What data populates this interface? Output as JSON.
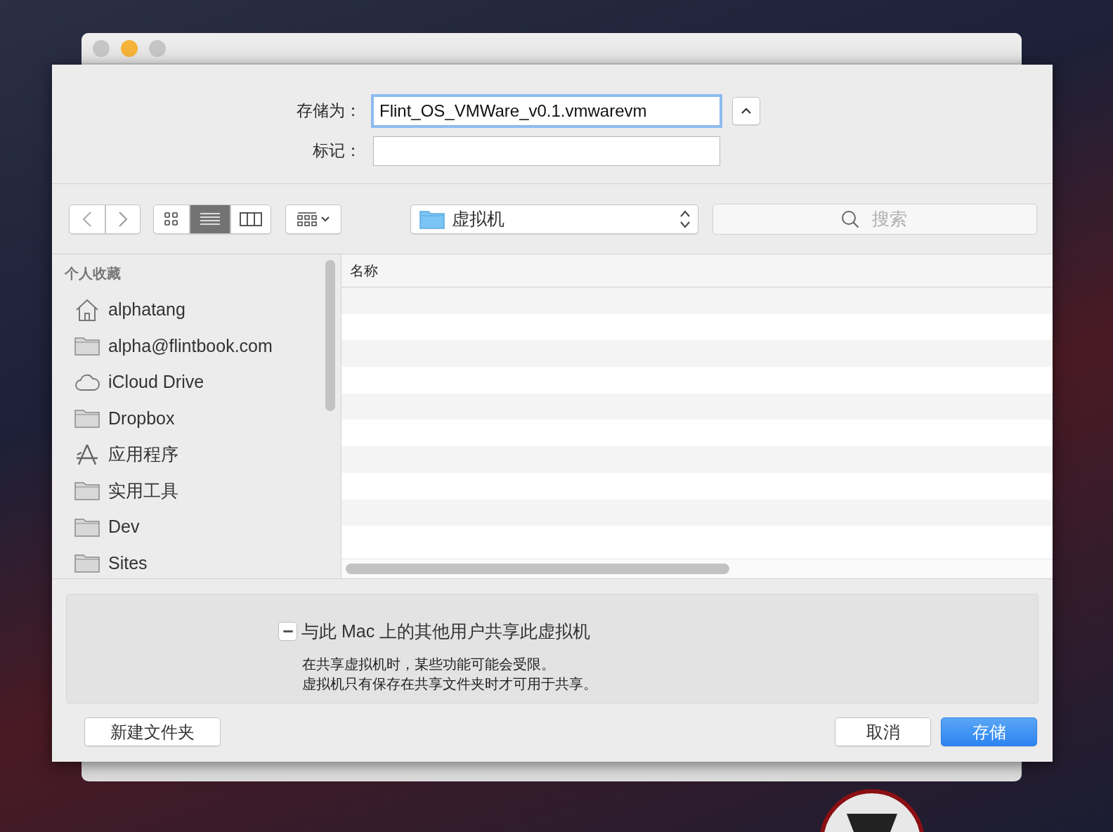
{
  "window": {
    "traffic_lights": [
      {
        "color": "#c6c6c6"
      },
      {
        "color": "#f6b33a"
      },
      {
        "color": "#c6c6c6"
      }
    ]
  },
  "form": {
    "fields": [
      {
        "label": "存储为：",
        "value": "Flint_OS_VMWare_v0.1.vmwarevm",
        "focused": true
      },
      {
        "label": "标记：",
        "focused": false
      }
    ]
  },
  "toolbar": {
    "view_modes": [
      {
        "kind": "icons",
        "selected": false
      },
      {
        "kind": "list",
        "selected": true
      },
      {
        "kind": "columns",
        "selected": false
      }
    ],
    "location": "虚拟机",
    "search": {
      "placeholder": "搜索"
    }
  },
  "sidebar": {
    "heading": "个人收藏",
    "items": [
      {
        "label": "alphatang",
        "kind": "home"
      },
      {
        "label": "alpha@flintbook.com",
        "kind": "folder"
      },
      {
        "label": "iCloud Drive",
        "kind": "cloud"
      },
      {
        "label": "Dropbox",
        "kind": "folder"
      },
      {
        "label": "应用程序",
        "kind": "apps"
      },
      {
        "label": "实用工具",
        "kind": "folder"
      },
      {
        "label": "Dev",
        "kind": "folder"
      },
      {
        "label": "Sites",
        "kind": "folder"
      }
    ]
  },
  "file_list": {
    "columns": [
      "名称"
    ]
  },
  "accessory": {
    "checkbox": {
      "label": "与此 Mac 上的其他用户共享此虚拟机",
      "mixed": true
    },
    "notes": [
      "在共享虚拟机时，某些功能可能会受限。",
      "虚拟机只有保存在共享文件夹时才可用于共享。"
    ]
  },
  "buttons": [
    {
      "label": "新建文件夹",
      "kind": "plain"
    },
    {
      "label": "取消",
      "kind": "plain"
    },
    {
      "label": "存储",
      "kind": "default"
    }
  ]
}
